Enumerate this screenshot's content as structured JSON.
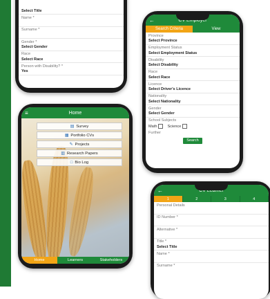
{
  "phone1": {
    "rows": [
      {
        "t": "Select Title",
        "k": "val"
      },
      {
        "t": "Name *",
        "k": "lbl"
      },
      {
        "t": "",
        "k": "gap"
      },
      {
        "t": "Surname *",
        "k": "lbl"
      },
      {
        "t": "",
        "k": "gap"
      },
      {
        "t": "Gender *",
        "k": "lbl"
      },
      {
        "t": "Select Gender",
        "k": "val"
      },
      {
        "t": "Race",
        "k": "lbl"
      },
      {
        "t": "Select Race",
        "k": "val"
      },
      {
        "t": "Person with Disability? *",
        "k": "lbl"
      },
      {
        "t": "Yes",
        "k": "val"
      }
    ]
  },
  "phone2": {
    "title": "CV Employer",
    "back": "←",
    "tabs": [
      "Search Criteria",
      "View"
    ],
    "rows": [
      {
        "t": "Province",
        "k": "lbl"
      },
      {
        "t": "Select Province",
        "k": "val"
      },
      {
        "t": "Employment Status",
        "k": "lbl"
      },
      {
        "t": "Select Employment Status",
        "k": "val"
      },
      {
        "t": "Disability",
        "k": "lbl"
      },
      {
        "t": "Select Disability",
        "k": "val"
      },
      {
        "t": "Race",
        "k": "lbl"
      },
      {
        "t": "Select Race",
        "k": "val"
      },
      {
        "t": "Licence",
        "k": "lbl"
      },
      {
        "t": "Select Driver's Licence",
        "k": "val"
      },
      {
        "t": "Nationality",
        "k": "lbl"
      },
      {
        "t": "Select Nationality",
        "k": "val"
      },
      {
        "t": "Gender",
        "k": "lbl"
      },
      {
        "t": "Select Gender",
        "k": "val"
      },
      {
        "t": "School Subjects",
        "k": "lbl"
      }
    ],
    "check1": "Math",
    "check2": "Science",
    "extra": "Further",
    "search": "Search"
  },
  "phone3": {
    "title": "Home",
    "menu": [
      {
        "label": "Survey",
        "icon": "survey-icon"
      },
      {
        "label": "Portfolio CVs",
        "icon": "cv-icon"
      },
      {
        "label": "Projects",
        "icon": "tools-icon"
      },
      {
        "label": "Research Papers",
        "icon": "paper-icon"
      },
      {
        "label": "Bio Log",
        "icon": "log-icon"
      }
    ],
    "nav": [
      "Home",
      "Learners",
      "Stakeholders"
    ]
  },
  "phone4": {
    "title": "CV Learner",
    "back": "←",
    "tabs": [
      "1",
      "2",
      "3",
      "4"
    ],
    "rows": [
      {
        "t": "Personal Details",
        "k": "lbl"
      },
      {
        "t": "",
        "k": "gap"
      },
      {
        "t": "ID Number *",
        "k": "lbl"
      },
      {
        "t": "",
        "k": "gap"
      },
      {
        "t": "Alternative *",
        "k": "lbl"
      },
      {
        "t": "",
        "k": "gap"
      },
      {
        "t": "Title *",
        "k": "lbl"
      },
      {
        "t": "Select Title",
        "k": "val"
      },
      {
        "t": "Name *",
        "k": "lbl"
      },
      {
        "t": "",
        "k": "gap"
      },
      {
        "t": "Surname *",
        "k": "lbl"
      }
    ]
  },
  "colors": {
    "green": "#1f8a3a",
    "orange": "#f2a516",
    "stripe": "#1f7a34"
  }
}
